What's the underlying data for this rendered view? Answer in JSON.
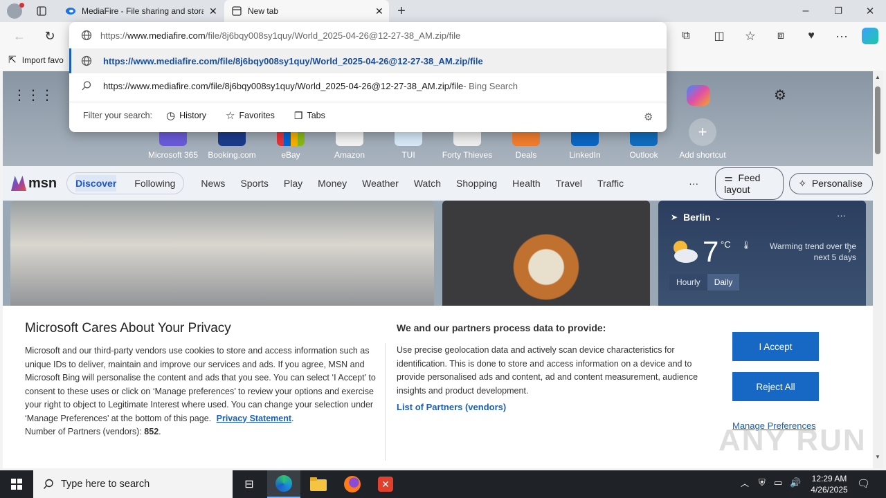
{
  "browser": {
    "tabs": [
      {
        "title": "MediaFire - File sharing and stora",
        "icon": "mediafire-icon"
      },
      {
        "title": "New tab",
        "icon": "newtab-icon"
      }
    ],
    "address": {
      "value_prefix": "https://",
      "value_host": "www.mediafire.com",
      "value_path": "/file/8j6bqy008sy1quy/World_2025-04-26@12-27-38_AM.zip/file"
    },
    "suggestions": [
      {
        "text": "https://www.mediafire.com/file/8j6bqy008sy1quy/World_2025-04-26@12-27-38_AM.zip/file",
        "suffix": ""
      },
      {
        "text": "https://www.mediafire.com/file/8j6bqy008sy1quy/World_2025-04-26@12-27-38_AM.zip/file",
        "suffix": " - Bing Search"
      }
    ],
    "filter": {
      "label": "Filter your search:",
      "history": "History",
      "favorites": "Favorites",
      "tabs": "Tabs"
    },
    "favbar": {
      "import": "Import favo"
    }
  },
  "newtab": {
    "shortcuts": [
      "Microsoft 365",
      "Booking.com",
      "eBay",
      "Amazon",
      "TUI",
      "Forty Thieves",
      "Deals",
      "LinkedIn",
      "Outlook",
      "Add shortcut"
    ],
    "msn": {
      "logo": "msn",
      "pills": [
        "Discover",
        "Following"
      ],
      "nav": [
        "News",
        "Sports",
        "Play",
        "Money",
        "Weather",
        "Watch",
        "Shopping",
        "Health",
        "Travel",
        "Traffic"
      ],
      "more": "···",
      "feed_layout": "Feed layout",
      "personalise": "Personalise"
    },
    "weather": {
      "city": "Berlin",
      "temp": "7",
      "unit": "°C",
      "trend": "Warming trend over the next 5 days",
      "tab_hourly": "Hourly",
      "tab_daily": "Daily"
    }
  },
  "privacy": {
    "title": "Microsoft Cares About Your Privacy",
    "body": "Microsoft and our third-party vendors use cookies to store and access information such as unique IDs to deliver, maintain and improve our services and ads. If you agree, MSN and Microsoft Bing will personalise the content and ads that you see. You can select ‘I Accept’ to consent to these uses or click on ‘Manage preferences’ to review your options and exercise your right to object to Legitimate Interest where used.  You can change your selection under ‘Manage Preferences’ at the bottom of this page.",
    "privacy_link": "Privacy Statement",
    "partners_label": "Number of Partners (vendors):",
    "partners_count": "852",
    "right_title": "We and our partners process data to provide:",
    "right_body": "Use precise geolocation data and actively scan device characteristics for identification. This is done to store and access information on a device and to provide personalised ads and content, ad and content measurement, audience insights and product development.",
    "list_link": "List of Partners (vendors)",
    "accept": "I Accept",
    "reject": "Reject All",
    "manage": "Manage Preferences"
  },
  "taskbar": {
    "search_placeholder": "Type here to search",
    "time": "12:29 AM",
    "date": "4/26/2025"
  },
  "watermark": "ANY RUN"
}
